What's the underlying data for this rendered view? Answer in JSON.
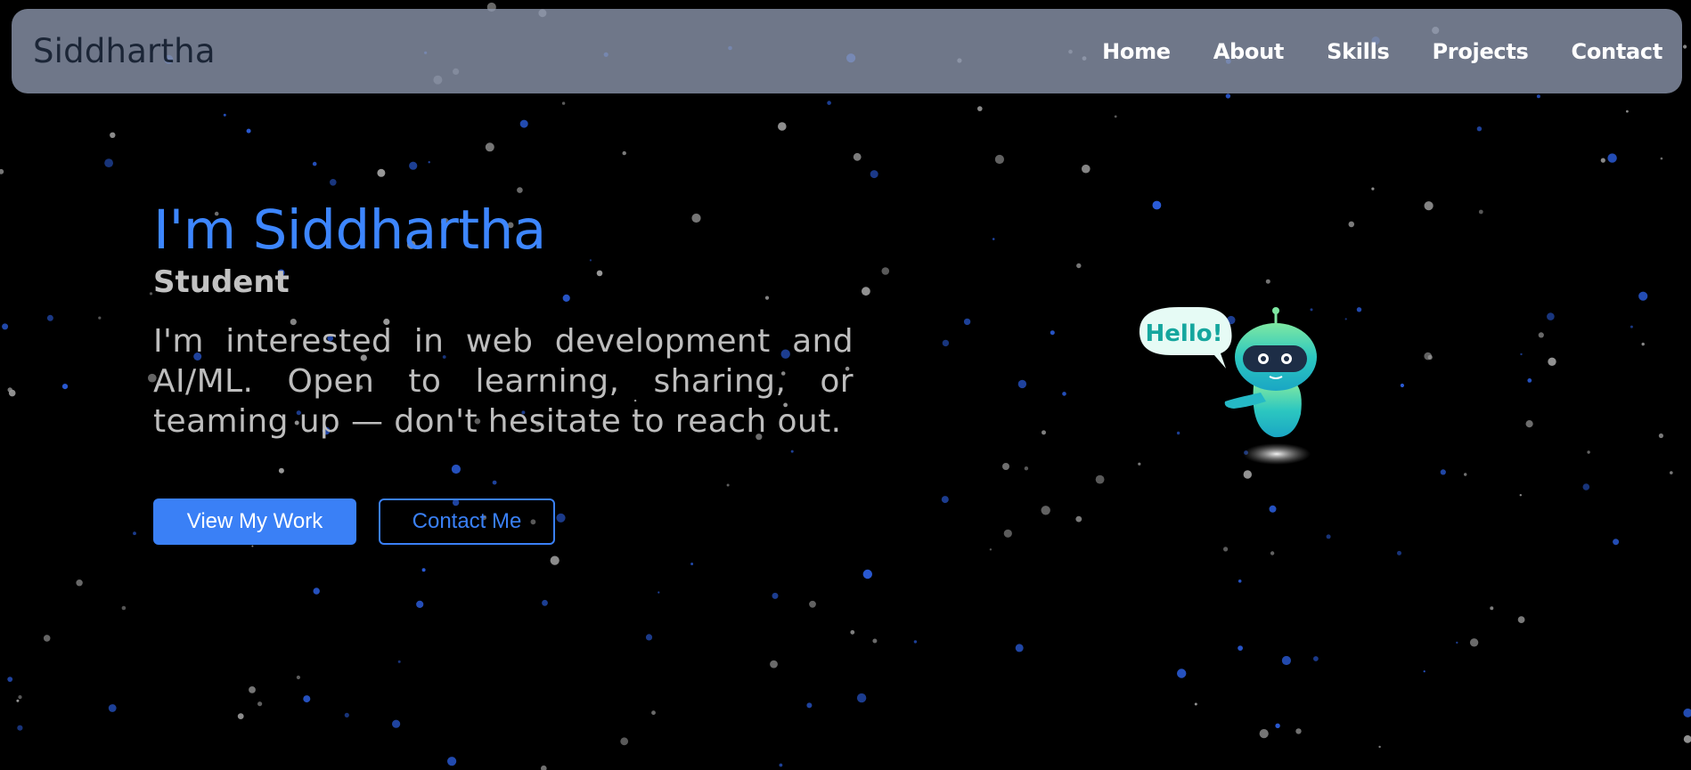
{
  "navbar": {
    "brand": "Siddhartha",
    "links": [
      {
        "label": "Home"
      },
      {
        "label": "About"
      },
      {
        "label": "Skills"
      },
      {
        "label": "Projects"
      },
      {
        "label": "Contact"
      }
    ]
  },
  "hero": {
    "title": "I'm Siddhartha",
    "subtitle": "Student",
    "description": "I'm interested in web development and AI/ML. Open to learning, sharing, or teaming up — don't hesitate to reach out.",
    "primary_button": "View My Work",
    "secondary_button": "Contact Me"
  },
  "robot": {
    "speech_bubble_text": "Hello!",
    "icon": "robot-icon"
  },
  "colors": {
    "background": "#000000",
    "accent": "#3a80f6",
    "navbar_bg": "rgba(142,153,175,0.78)",
    "robot_body": "#2cc7c0",
    "star_blue": "#2a5bd7",
    "star_gray": "#9a9a9a"
  }
}
